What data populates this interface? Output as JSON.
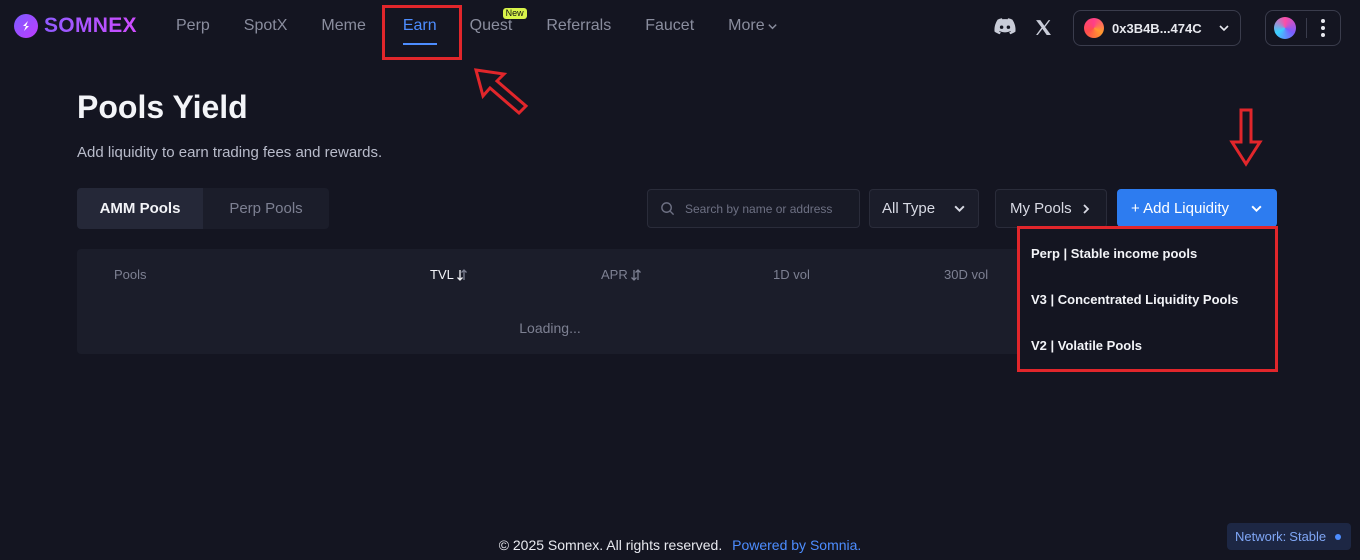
{
  "brand": {
    "name": "SOMNEX"
  },
  "nav": {
    "items": [
      {
        "label": "Perp"
      },
      {
        "label": "SpotX"
      },
      {
        "label": "Meme"
      },
      {
        "label": "Earn"
      },
      {
        "label": "Quest",
        "badge": "New"
      },
      {
        "label": "Referrals"
      },
      {
        "label": "Faucet"
      },
      {
        "label": "More"
      }
    ],
    "active": "Earn"
  },
  "header": {
    "icons": [
      "discord-icon",
      "x-icon"
    ],
    "wallet_address": "0x3B4B...474C"
  },
  "page": {
    "title": "Pools Yield",
    "subtitle": "Add liquidity to earn trading fees and rewards."
  },
  "tabs": [
    {
      "label": "AMM Pools",
      "active": true
    },
    {
      "label": "Perp Pools",
      "active": false
    }
  ],
  "filters": {
    "search_placeholder": "Search by name or address",
    "type_select": "All Type",
    "my_pools": "My Pools",
    "add_liquidity": "+ Add Liquidity"
  },
  "table": {
    "columns": [
      {
        "label": "Pools"
      },
      {
        "label": "TVL"
      },
      {
        "label": "APR"
      },
      {
        "label": "1D vol"
      },
      {
        "label": "30D vol"
      }
    ],
    "status": "Loading..."
  },
  "add_liquidity_menu": [
    "Perp | Stable income pools",
    "V3 | Concentrated Liquidity Pools",
    "V2 | Volatile Pools"
  ],
  "footer": {
    "copyright": "© 2025 Somnex. All rights reserved.",
    "powered_by": "Powered by Somnia."
  },
  "network": {
    "label": "Network:",
    "value": "Stable"
  },
  "colors": {
    "accent": "#2d7cf0",
    "active_nav": "#4d8dff",
    "annotation": "#e1262b",
    "background": "#141521"
  }
}
